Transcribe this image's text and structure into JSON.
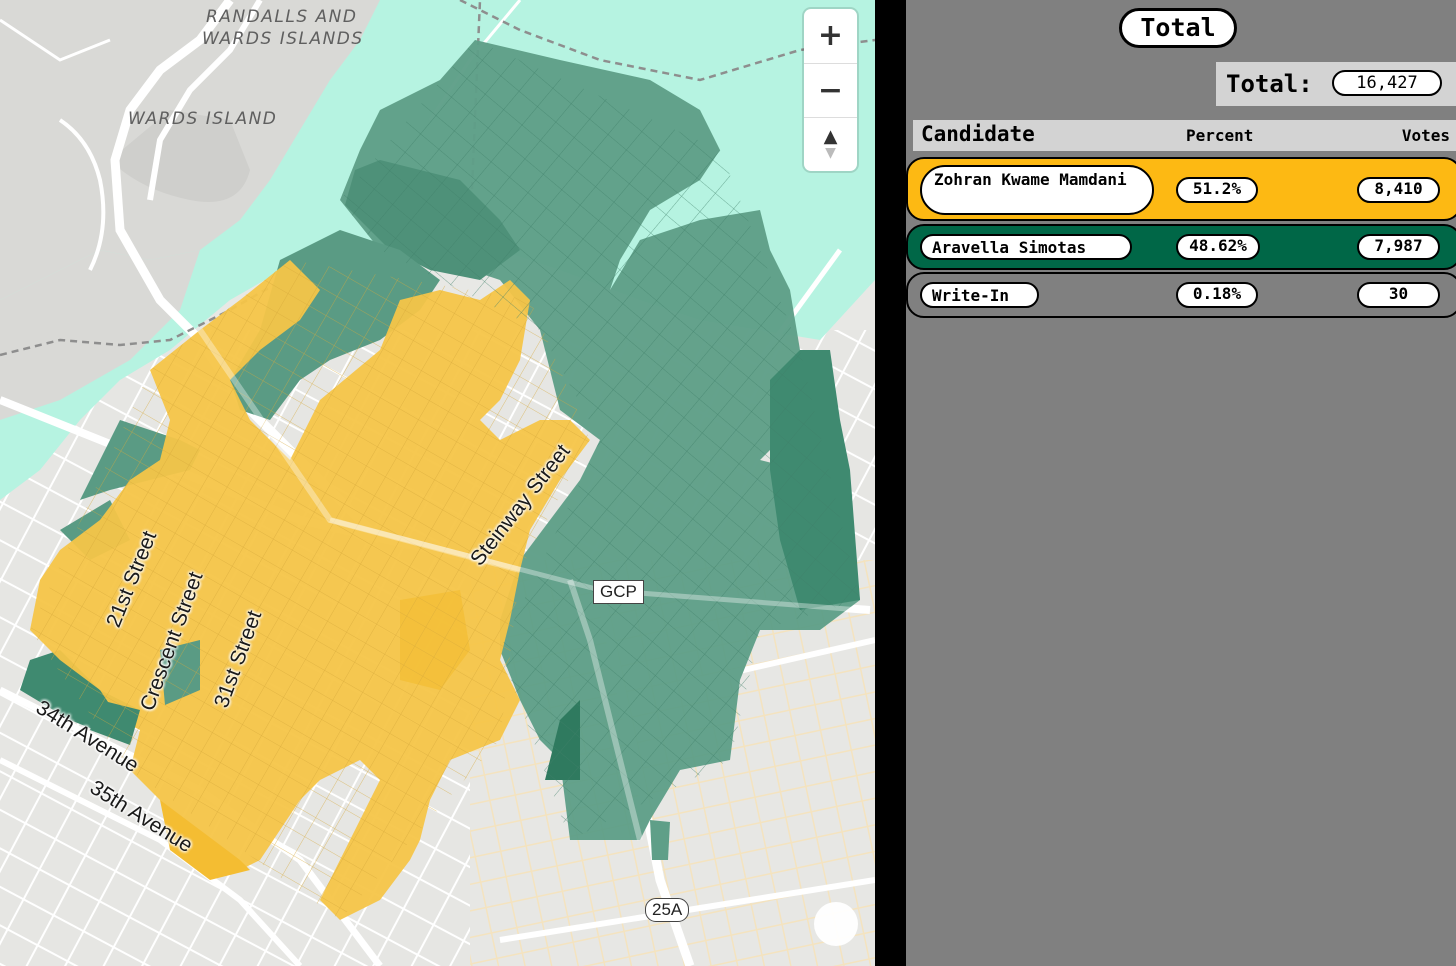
{
  "map": {
    "place_labels": [
      "RANDALLS AND",
      "WARDS ISLANDS",
      "WARDS ISLAND"
    ],
    "street_labels": [
      "Steinway Street",
      "21st Street",
      "Crescent Street",
      "31st Street",
      "34th Avenue",
      "35th Avenue"
    ],
    "route_shields": [
      "GCP",
      "25A"
    ],
    "controls": {
      "zoom_in_icon": "plus-icon",
      "zoom_out_icon": "minus-icon",
      "compass_icon": "compass-icon",
      "zoom_in": "+",
      "zoom_out": "−",
      "compass_north": "▲",
      "compass_south": "▼"
    },
    "colors": {
      "water": "#b6f3e1",
      "land": "#e9e9e6",
      "mamdani": "#f6c548",
      "simotas": "#5a9e86",
      "simotas_strong": "#3e8a6f",
      "street_grid": "#f5e6c4"
    }
  },
  "panel": {
    "title": "Total",
    "total_label": "Total:",
    "total_votes": "16,427",
    "headers": {
      "candidate": "Candidate",
      "percent": "Percent",
      "votes": "Votes"
    },
    "candidates": [
      {
        "name": "Zohran Kwame Mamdani",
        "percent": "51.2%",
        "votes": "8,410",
        "color": "#fdb913"
      },
      {
        "name": "Aravella Simotas",
        "percent": "48.62%",
        "votes": "7,987",
        "color": "#006747"
      },
      {
        "name": "Write-In",
        "percent": "0.18%",
        "votes": "30",
        "color": "#808080"
      }
    ]
  }
}
